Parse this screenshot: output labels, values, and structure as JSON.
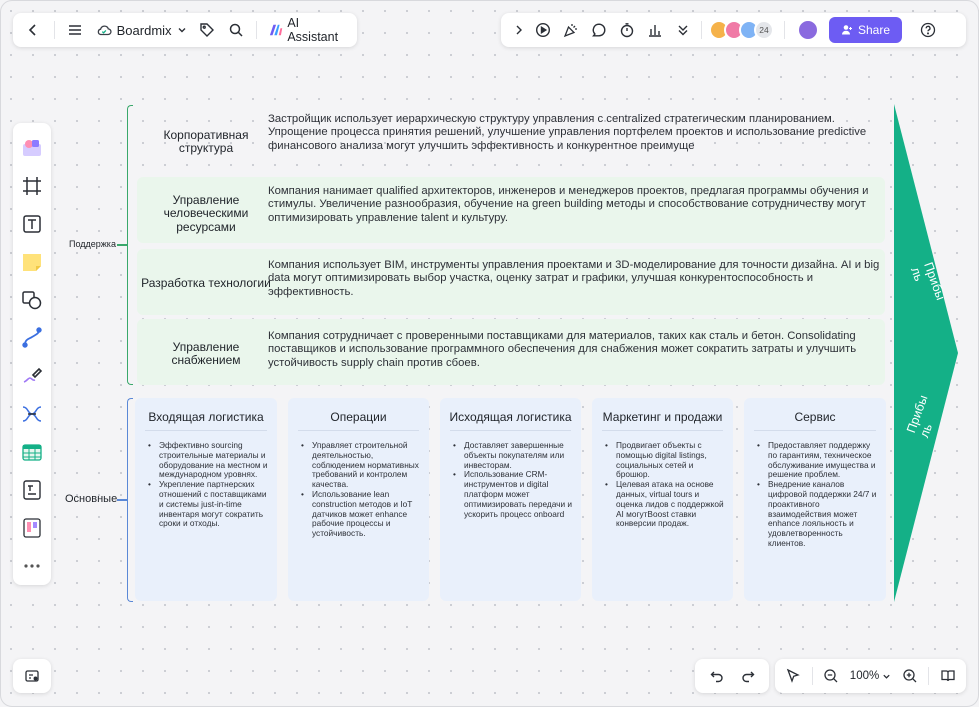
{
  "toolbar_left": {
    "app_name": "Boardmix",
    "ai_label": "AI Assistant"
  },
  "toolbar_right": {
    "collab_count": "24",
    "share_label": "Share"
  },
  "zoom": {
    "level": "100%"
  },
  "colors": {
    "accent": "#6d5cf3",
    "arrow": "#14b087",
    "row_bg": "#eaf6ec",
    "card_bg": "#e9f0fb",
    "support_bracket": "#3aa86b",
    "primary_bracket": "#5a88d6"
  },
  "diagram": {
    "support_label": "Поддержка",
    "primary_label": "Основные",
    "margin_top": "Прибы ль",
    "margin_bottom": "Прибы ль",
    "support_rows": [
      {
        "title": "Корпоративная структура",
        "desc": "Застройщик использует иерархическую структуру управления с centralized стратегическим планированием. Упрощение процесса принятия решений, улучшение управления портфелем проектов и использование predictive финансового анализа могут улучшить эффективность и конкурентное преимуще"
      },
      {
        "title": "Управление человеческими ресурсами",
        "desc": "Компания нанимает qualified архитекторов, инженеров и менеджеров проектов, предлагая программы обучения и стимулы. Увеличение разнообразия, обучение на green building методы и способствование сотрудничеству могут оптимизировать управление talent и культуру."
      },
      {
        "title": "Разработка технологии",
        "desc": "Компания использует BIM, инструменты управления проектами и 3D-моделирование для точности дизайна. AI и big data могут оптимизировать выбор участка, оценку затрат и графики, улучшая конкурентоспособность и эффективность."
      },
      {
        "title": "Управление снабжением",
        "desc": "Компания сотрудничает с проверенными поставщиками для материалов, таких как сталь и бетон. Consolidating поставщиков и использование программного обеспечения для снабжения может сократить затраты и улучшить устойчивость supply chain против сбоев."
      }
    ],
    "primary_cards": [
      {
        "title": "Входящая логистика",
        "items": [
          "Эффективно sourcing строительные материалы и оборудование на местном и международном уровнях.",
          "Укрепление партнерских отношений с поставщиками и системы just-in-time инвентаря могут сократить сроки и отходы."
        ]
      },
      {
        "title": "Операции",
        "items": [
          "Управляет строительной деятельностью, соблюдением нормативных требований и контролем качества.",
          "Использование lean construction методов и IoT датчиков может enhance рабочие процессы и устойчивость."
        ]
      },
      {
        "title": "Исходящая логистика",
        "items": [
          "Доставляет завершенные объекты покупателям или инвесторам.",
          "Использование CRM-инструментов и digital платформ может оптимизировать передачи и ускорить процесс onboard"
        ]
      },
      {
        "title": "Маркетинг и продажи",
        "items": [
          "Продвигает объекты с помощью digital listings, социальных сетей и брошюр.",
          "Целевая атака на основе данных, virtual tours и оценка лидов с поддержкой AI могутBoost ставки конверсии продаж."
        ]
      },
      {
        "title": "Сервис",
        "items": [
          "Предоставляет поддержку по гарантиям, техническое обслуживание имущества и решение проблем.",
          "Внедрение каналов цифровой поддержки 24/7 и проактивного взаимодействия может enhance лояльность и удовлетворенность клиентов."
        ]
      }
    ]
  }
}
